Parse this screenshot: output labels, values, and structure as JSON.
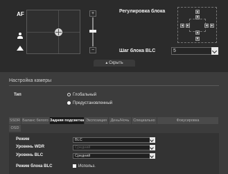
{
  "preview": {
    "af_label": "AF"
  },
  "zoom": {
    "plus": "+",
    "minus": "−"
  },
  "block": {
    "title": "Регулировка блока"
  },
  "blc_step": {
    "label": "Шаг блока BLC",
    "value": "5"
  },
  "hide_label": "▴ Скрыть",
  "camera": {
    "section_title": "Настройка камеры",
    "type_label": "Тип",
    "type_options": [
      "Глобальный",
      "Предустановленный"
    ],
    "type_selected": "Предустановленный"
  },
  "tabs": [
    "SSDR",
    "Баланс белого",
    "Задняя подсветка",
    "Экспозиция",
    "День/Ночь",
    "Специально",
    "Фокусировка",
    "OSD"
  ],
  "active_tab": "Задняя подсветка",
  "form": {
    "mode_label": "Режим",
    "mode_value": "BLC",
    "wdr_label": "Уровень WDR",
    "wdr_value": "Средний",
    "blc_level_label": "Уровень BLC",
    "blc_level_value": "Средний",
    "blc_mode_label": "Режим блока BLC",
    "blc_mode_option": "Использ."
  }
}
